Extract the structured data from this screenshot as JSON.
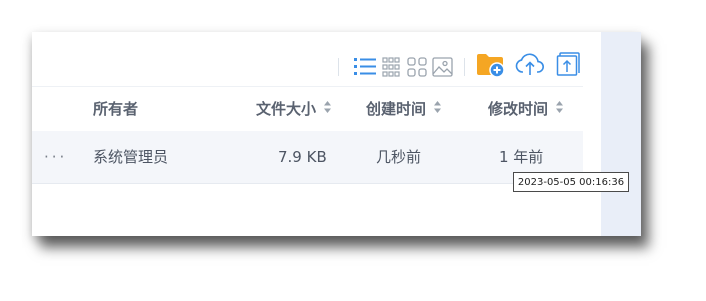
{
  "toolbar": {
    "icons": [
      "list-view-icon",
      "grid-small-view-icon",
      "grid-large-view-icon",
      "image-view-icon",
      "new-folder-icon",
      "upload-icon",
      "upload-file-icon"
    ],
    "active_color": "#3a8ee6",
    "folder_color": "#f5a623",
    "icon_color": "#3a8ee6",
    "inactive_color": "#9aa3ad"
  },
  "columns": {
    "owner": "所有者",
    "size": "文件大小",
    "created": "创建时间",
    "modified": "修改时间"
  },
  "rows": [
    {
      "more": "···",
      "owner": "系统管理员",
      "size": "7.9 KB",
      "created": "几秒前",
      "modified": "1 年前"
    }
  ],
  "tooltip": {
    "text": "2023-05-05 00:16:36"
  }
}
